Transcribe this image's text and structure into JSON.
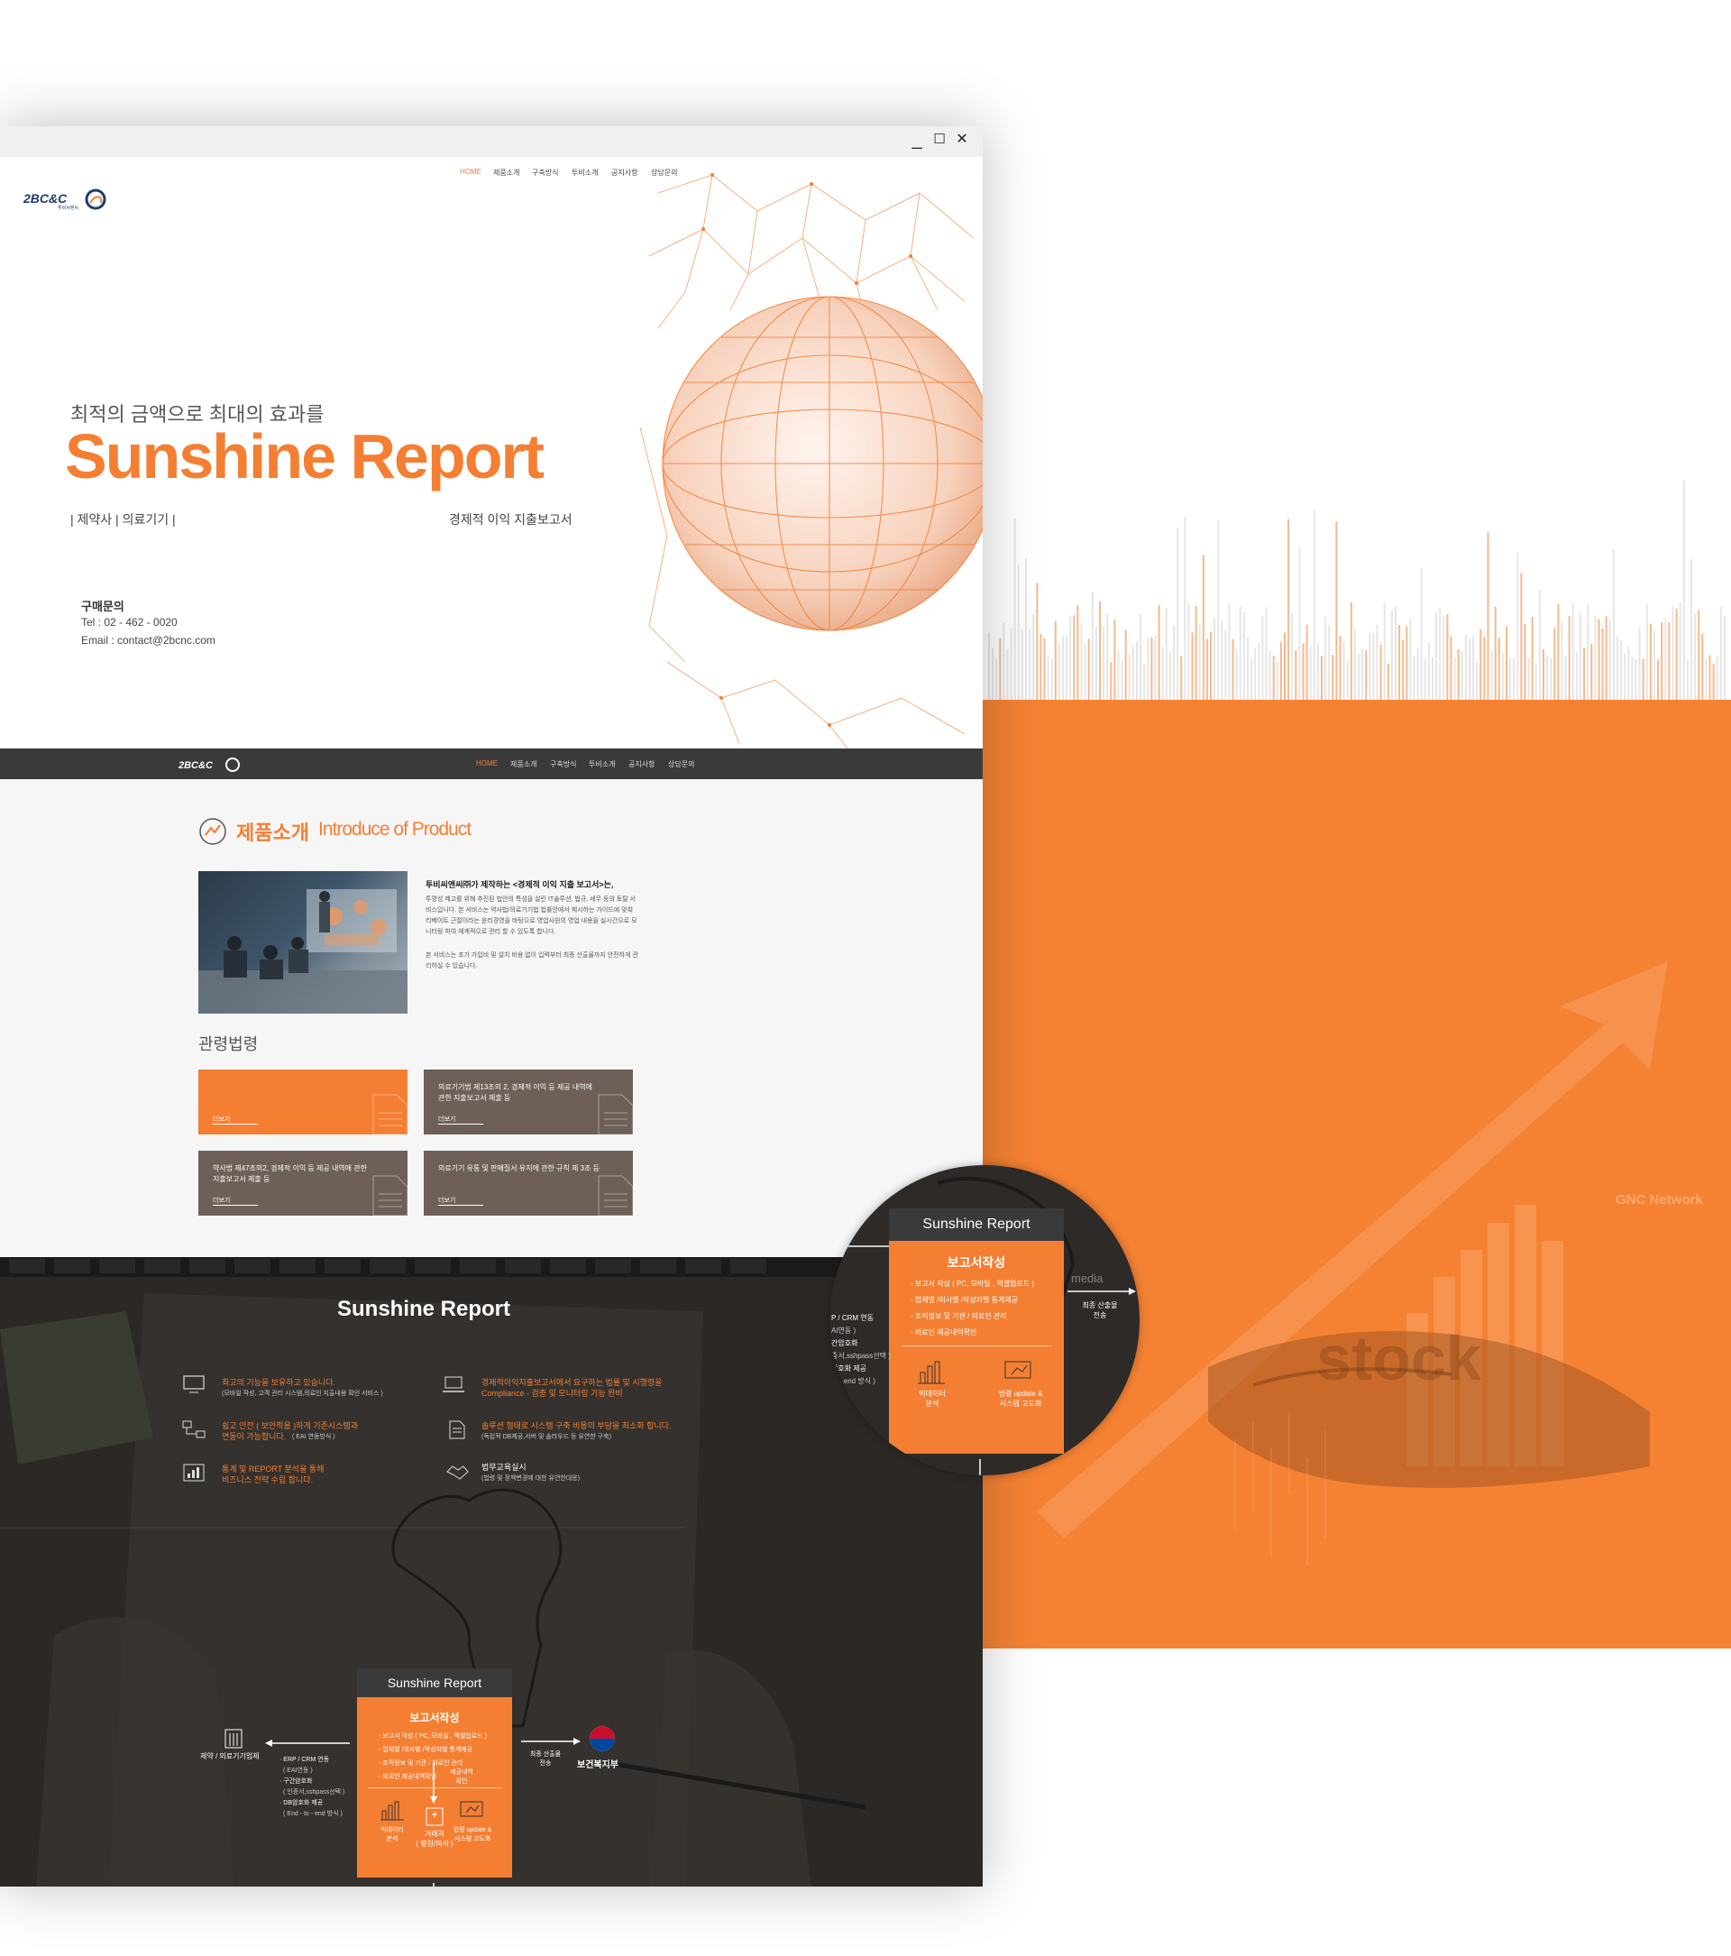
{
  "window": {
    "minimize": "_",
    "maximize": "☐",
    "close": "✕"
  },
  "hero": {
    "logo": "2BC&C",
    "logo_sub": "투비씨앤씨",
    "nav": [
      "HOME",
      "제품소개",
      "구축방식",
      "투비소개",
      "공지사항",
      "상담문의"
    ],
    "subtitle": "최적의 금액으로 최대의 효과를",
    "title": "Sunshine Report",
    "categories": "|  제약사  |   의료기기  |",
    "right_caption": "경제적 이익 지출보고서",
    "contact_heading": "구매문의",
    "contact_tel": "Tel : 02 - 462 - 0020",
    "contact_email": "Email :  contact@2bcnc.com"
  },
  "dark_nav": {
    "logo": "2BC&C",
    "items": [
      "HOME",
      "제품소개",
      "구축방식",
      "투비소개",
      "공지사항",
      "상담문의"
    ]
  },
  "product": {
    "title": "제품소개",
    "title_en": "Introduce of Product",
    "intro_heading": "투비씨앤씨㈜가 제작하는 <경제적 이익 지출 보고서>는,",
    "intro_body": "투명성 제고를 위해 추진된 법안의 특성을 살린 IT솔루션, 법규, 세무 등의 토탈 서비스입니다. 본 서비스는 약사법/의료기기법 법률안에서 제시하는 가이드에 맞춰 리베이트 근절이라는 윤리경영을 바탕으로 영업사원의 영업 내용을 실시간으로 모니터링 하여 체계적으로 관리 할 수 있도록 합니다.",
    "intro_body2": "본 서비스는 조기 가입비 및 설치 비용 없이 입력부터 최종 산출물까지 안전하게 관리하실 수 있습니다.",
    "law_heading": "관령법령",
    "cards": [
      {
        "text": "",
        "more": "더보기"
      },
      {
        "text": "의료기기법 제13조의 2, 경제적 이익 등 제공 내역에 관한 지출보고서 제출 등",
        "more": "더보기"
      },
      {
        "text": "약사법 제47조의2, 경제적 이익 등 제공 내역에 관한 지출보고서 제출 등",
        "more": "더보기"
      },
      {
        "text": "의료기기 유통 및 판매질서 유지에 관한 규칙 제 3조 등",
        "more": "더보기"
      }
    ]
  },
  "flow": {
    "title": "Sunshine Report",
    "features_left": [
      {
        "title": "최고의 기능을 보유하고 있습니다.",
        "sub": "(모바일 작성, 고객 관리 시스템,의료인 지출내용 확인 서비스 )"
      },
      {
        "title": "쉽고 안전 ( 보안적용 )하게 기존시스템과",
        "title2": "연동이 가능합니다.",
        "sub": "( EAI 연동방식 )"
      },
      {
        "title": "통계 및 REPORT 분석을 통해",
        "title2": "비즈니스 전략 수립 합니다."
      }
    ],
    "features_right": [
      {
        "title": "경제적이익지출보고서에서 요구하는 법률 및 시행령을",
        "title2": "Compliance - 검증 및 모니터링 기능 완비"
      },
      {
        "title": "솔루션 형태로 시스템 구축 비용의 부담을 최소화 합니다.",
        "sub": "(독립적 DB제공,서버 및 솔라우드 등 유연한 구축)"
      },
      {
        "title": "법무교육실시",
        "sub": "(법령 및 정책변경에 대한 유연한대응)"
      }
    ],
    "box_title": "Sunshine Report",
    "box_heading": "보고서작성",
    "box_items": [
      "- 보고서 작성 ( PC, 모바일 , 엑셀업로드 )",
      "- 업체별 /의사별 /작성자별 통계제공",
      "- 조직정보 및 기관 / 의료인 관리",
      "- 의료인 제공내역확인"
    ],
    "box_icon1": "빅데이터\n분석",
    "box_icon2": "법령 update &\n시스템 고도화",
    "left_node": "제약 / 의료기기업체",
    "left_list": [
      "· ERP / CRM 연동",
      "( EAI연동 )",
      "· 구간암호화",
      "( 인증서,sshpass선택 )",
      "· DB암호화 제공",
      "( End - to - end 방식 )"
    ],
    "right_arrow_label": "최종 산출물\n전송",
    "right_node": "보건복지부",
    "down_arrow_label": "제공내역\n확인",
    "bottom_node": "거래처\n( 병원/의사 )"
  },
  "zoom": {
    "box_title": "Sunshine Report",
    "box_heading": "보고서작성",
    "box_items": [
      "- 보고서 작성 ( PC, 모바일 , 엑셀업로드 )",
      "- 업체별 /의사별 /작성자별 통계제공",
      "- 조직정보 및 기관 / 의료인 관리",
      "- 의료인 제공내역확인"
    ],
    "icon1": "빅데이터\n분석",
    "icon2": "법령 update &\n시스템 고도화",
    "left_list": [
      "P / CRM 연동",
      "AI연동 )",
      "간암호화",
      "증서,sshpass선택 )",
      "암호화 제공",
      "to - end 방식 )"
    ],
    "right_label": "최종 산출물\n전송",
    "down_label": "제공내역\n확인",
    "media": "media"
  },
  "deco": {
    "gnc": "GNC Network",
    "stock": "stock"
  },
  "colors": {
    "accent": "#f47f33",
    "dark": "#3a3a3a",
    "card_brown": "#6e6058"
  }
}
